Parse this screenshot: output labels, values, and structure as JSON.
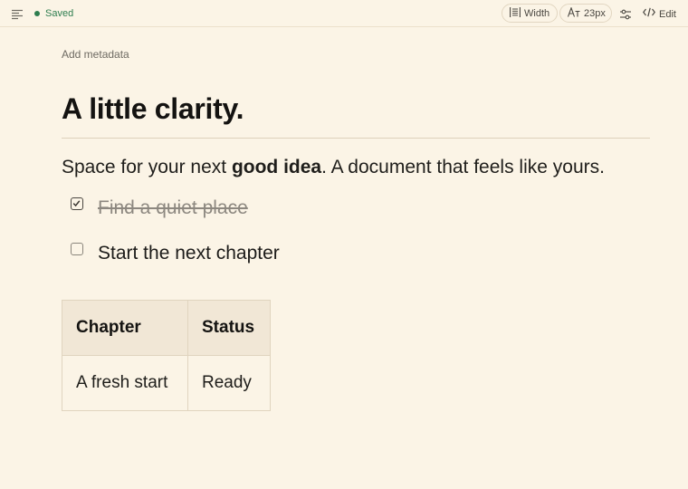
{
  "toolbar": {
    "menu_icon": "menu-lines-icon",
    "status": {
      "label": "Saved",
      "color": "#2e7d4f"
    },
    "width_button": {
      "label": "Width",
      "icon": "width-icon"
    },
    "font_size_button": {
      "label": "23px",
      "icon": "font-size-icon"
    },
    "settings_icon": "sliders-icon",
    "edit_button": {
      "label": "Edit",
      "icon": "code-icon"
    }
  },
  "document": {
    "add_metadata": "Add metadata",
    "title": "A little clarity.",
    "paragraph": {
      "before": "Space for your next ",
      "bold": "good idea",
      "after": ". A document that feels like yours."
    },
    "tasks": [
      {
        "text": "Find a quiet place",
        "checked": true
      },
      {
        "text": "Start the next chapter",
        "checked": false
      }
    ],
    "table": {
      "headers": [
        "Chapter",
        "Status"
      ],
      "rows": [
        [
          "A fresh start",
          "Ready"
        ]
      ]
    }
  },
  "colors": {
    "background": "#fbf4e6",
    "accent_green": "#2e7d4f",
    "table_header_bg": "#f1e7d6"
  }
}
